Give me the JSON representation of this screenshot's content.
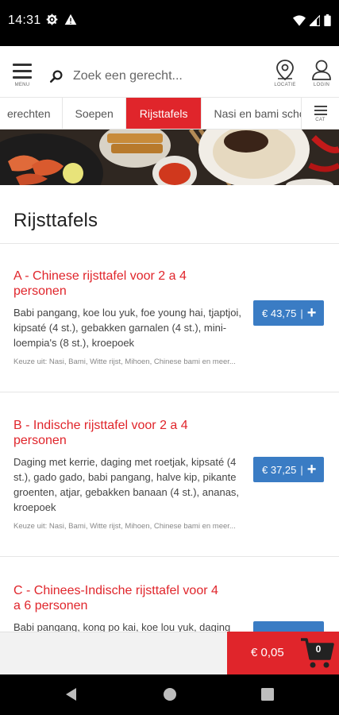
{
  "status_bar": {
    "time": "14:31"
  },
  "header": {
    "menu_label": "MENU",
    "search_placeholder": "Zoek een gerecht...",
    "location_label": "LOCATIE",
    "login_label": "LOGIN"
  },
  "categories": {
    "tabs": [
      {
        "label": "erechten"
      },
      {
        "label": "Soepen"
      },
      {
        "label": "Rijsttafels",
        "active": true
      },
      {
        "label": "Nasi en bami schotel"
      }
    ],
    "menu_label": "CAT"
  },
  "section": {
    "title": "Rijsttafels"
  },
  "dishes": [
    {
      "title": "A - Chinese rijsttafel voor 2 a 4 personen",
      "description": "Babi pangang, koe lou yuk, foe young hai, tjaptjoi, kipsaté (4 st.), gebakken garnalen (4 st.), mini-loempia's (8 st.), kroepoek",
      "extra": "Keuze uit: Nasi, Bami, Witte rijst, Mihoen, Chinese bami en meer...",
      "price": "€ 43,75",
      "separator": "|",
      "plus": "+"
    },
    {
      "title": "B - Indische rijsttafel voor 2 a 4 personen",
      "description": "Daging met kerrie, daging met roetjak, kipsaté (4 st.), gado gado, babi pangang, halve kip, pikante groenten, atjar, gebakken banaan (4 st.), ananas, kroepoek",
      "extra": "Keuze uit: Nasi, Bami, Witte rijst, Mihoen, Chinese bami en meer...",
      "price": "€ 37,25",
      "separator": "|",
      "plus": "+"
    },
    {
      "title": "C - Chinees-Indische rijsttafel voor 4 a 6 personen",
      "description": "Babi pangang, kong po kai, koe lou yuk, daging"
    }
  ],
  "cart": {
    "total": "€ 0,05",
    "count": "0"
  },
  "colors": {
    "accent": "#e0252b",
    "price_button": "#3a7cc4"
  }
}
